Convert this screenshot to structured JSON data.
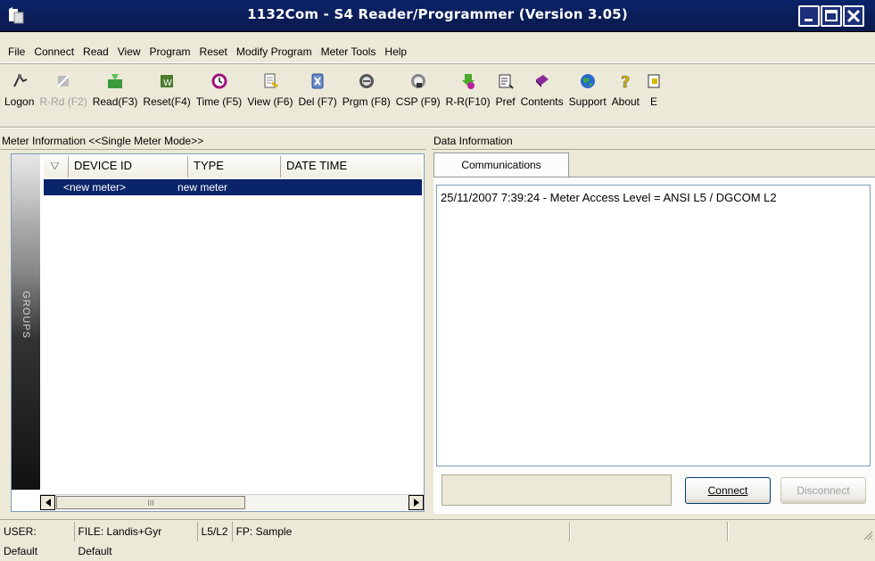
{
  "window": {
    "title": "1132Com - S4 Reader/Programmer (Version 3.05)"
  },
  "menu": [
    "File",
    "Connect",
    "Read",
    "View",
    "Program",
    "Reset",
    "Modify Program",
    "Meter Tools",
    "Help"
  ],
  "toolbar": [
    {
      "label": "Logon",
      "icon": "logon-icon",
      "disabled": false
    },
    {
      "label": "R-Rd (F2)",
      "icon": "reread-icon",
      "disabled": true
    },
    {
      "label": "Read(F3)",
      "icon": "read-icon",
      "disabled": false
    },
    {
      "label": "Reset(F4)",
      "icon": "reset-icon",
      "disabled": false
    },
    {
      "label": "Time (F5)",
      "icon": "time-icon",
      "disabled": false
    },
    {
      "label": "View (F6)",
      "icon": "view-icon",
      "disabled": false
    },
    {
      "label": "Del (F7)",
      "icon": "delete-icon",
      "disabled": false
    },
    {
      "label": "Prgm (F8)",
      "icon": "program-icon",
      "disabled": false
    },
    {
      "label": "CSP (F9)",
      "icon": "csp-icon",
      "disabled": false
    },
    {
      "label": "R-R(F10)",
      "icon": "read-reset-icon",
      "disabled": false
    },
    {
      "label": "Pref",
      "icon": "preferences-icon",
      "disabled": false
    },
    {
      "label": "Contents",
      "icon": "contents-icon",
      "disabled": false
    },
    {
      "label": "Support",
      "icon": "support-icon",
      "disabled": false
    },
    {
      "label": "About",
      "icon": "about-icon",
      "disabled": false
    },
    {
      "label": "E",
      "icon": "exit-icon",
      "disabled": false
    }
  ],
  "left_panel": {
    "header": "Meter Information <<Single Meter Mode>>",
    "groups_label": "GROUPS",
    "columns": [
      "DEVICE ID",
      "TYPE",
      "DATE TIME"
    ],
    "rows": [
      {
        "device_id": "<new meter>",
        "type": "new meter",
        "date_time": ""
      }
    ],
    "scroll_thumb_grip": "III"
  },
  "right_panel": {
    "header": "Data Information",
    "tab": "Communications",
    "log": "25/11/2007 7:39:24 - Meter Access Level = ANSI L5 / DGCOM L2",
    "connect_label": "Connect",
    "disconnect_label": "Disconnect"
  },
  "status": {
    "user": "USER: Default",
    "file": "FILE: Landis+Gyr Default",
    "level": "L5/L2",
    "fp": "FP: Sample"
  },
  "colors": {
    "title_bar": "#0a246a",
    "selection": "#0a246a",
    "face": "#ece9d8"
  }
}
